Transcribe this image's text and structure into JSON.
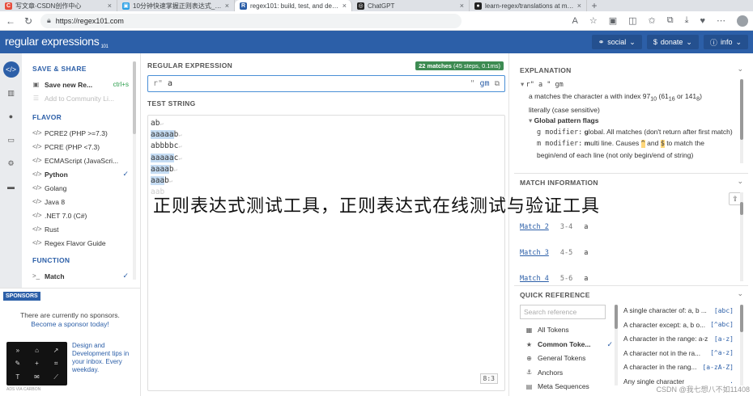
{
  "browser": {
    "tabs": [
      {
        "favicon": "C",
        "color": "#e74c3c",
        "title": "写文章-CSDN创作中心"
      },
      {
        "favicon": "▣",
        "color": "#2aa0e6",
        "title": "10分钟快速掌握正则表达式_脚本"
      },
      {
        "favicon": "R",
        "color": "#2c5fa8",
        "title": "regex101: build, test, and debug",
        "active": true
      },
      {
        "favicon": "◎",
        "color": "#222222",
        "title": "ChatGPT"
      },
      {
        "favicon": "●",
        "color": "#222222",
        "title": "learn-regex/translations at mast"
      }
    ],
    "url": "https://regex101.com"
  },
  "header": {
    "logo": "regular expressions",
    "logo_num": "101",
    "social_label": "social",
    "donate_label": "donate",
    "info_label": "info"
  },
  "sidebar": {
    "save_share_heading": "SAVE & SHARE",
    "save_label": "Save new Re...",
    "save_shortcut": "ctrl+s",
    "community_label": "Add to Community Li...",
    "flavor_heading": "FLAVOR",
    "flavors": [
      {
        "label": "PCRE2 (PHP >=7.3)",
        "selected": false
      },
      {
        "label": "PCRE (PHP <7.3)",
        "selected": false
      },
      {
        "label": "ECMAScript (JavaScri...",
        "selected": false
      },
      {
        "label": "Python",
        "selected": true
      },
      {
        "label": "Golang",
        "selected": false
      },
      {
        "label": "Java 8",
        "selected": false
      },
      {
        "label": ".NET 7.0 (C#)",
        "selected": false
      },
      {
        "label": "Rust",
        "selected": false
      },
      {
        "label": "Regex Flavor Guide",
        "selected": false
      }
    ],
    "function_heading": "FUNCTION",
    "function_label": "Match"
  },
  "sponsors": {
    "tag": "SPONSORS",
    "text": "There are currently no sponsors.",
    "link": "Become a sponsor today!",
    "ad_text": "Design and Development tips in your inbox. Every weekday.",
    "ad_note": "ADS VIA CARBON"
  },
  "regex": {
    "section_label": "REGULAR EXPRESSION",
    "matches_count": "22 matches",
    "matches_detail": "(45 steps, 0.1ms)",
    "prefix": "r\"",
    "pattern": "a",
    "suffix": "\"",
    "flags": "gm"
  },
  "test_string": {
    "section_label": "TEST STRING",
    "lines": [
      [
        {
          "t": "ab"
        }
      ],
      [
        {
          "t": "aaaaa",
          "h": true
        },
        {
          "t": "b"
        }
      ],
      [
        {
          "t": "abbbbc"
        }
      ],
      [
        {
          "t": "aaaaa",
          "h": true
        },
        {
          "t": "c"
        }
      ],
      [
        {
          "t": "aaaa",
          "h": true
        },
        {
          "t": "b"
        }
      ],
      [
        {
          "t": "aaa",
          "h": true
        },
        {
          "t": "b"
        }
      ]
    ],
    "faded_line": "aab",
    "ratio": "8:3"
  },
  "explanation": {
    "heading": "EXPLANATION",
    "pattern_line": "r\" a \" gm",
    "desc_a": "a matches the character a with index 97",
    "idx_sub1": "10",
    "idx_mid": " (61",
    "idx_sub2": "16",
    "idx_or": " or 141",
    "idx_sub3": "8",
    "idx_end": ")",
    "desc_b": "literally (case sensitive)",
    "flags_heading": "Global pattern flags",
    "g_code": "g modifier:",
    "g_bold": "g",
    "g_desc": "lobal. All matches (don't return after first match)",
    "m_code": "m modifier:",
    "m_bold": "m",
    "m_desc": "ulti line. Causes",
    "m_and": "and",
    "m_desc2": "to match the",
    "m_desc3": "begin/end of each line (not only begin/end of string)"
  },
  "match_info": {
    "heading": "MATCH INFORMATION",
    "items": [
      {
        "name": "Match 2",
        "range": "3-4",
        "value": "a"
      },
      {
        "name": "Match 3",
        "range": "4-5",
        "value": "a"
      },
      {
        "name": "Match 4",
        "range": "5-6",
        "value": "a"
      }
    ]
  },
  "quick_ref": {
    "heading": "QUICK REFERENCE",
    "search_placeholder": "Search reference",
    "categories": [
      {
        "icon": "▦",
        "label": "All Tokens",
        "bold": false
      },
      {
        "icon": "★",
        "label": "Common Toke...",
        "bold": true,
        "selected": true
      },
      {
        "icon": "⊕",
        "label": "General Tokens",
        "bold": false
      },
      {
        "icon": "⚓",
        "label": "Anchors",
        "bold": false
      },
      {
        "icon": "▤",
        "label": "Meta Sequences",
        "bold": false
      }
    ],
    "refs": [
      {
        "desc": "A single character of: a, b ...",
        "token": "[abc]"
      },
      {
        "desc": "A character except: a, b o...",
        "token": "[^abc]"
      },
      {
        "desc": "A character in the range: a-z",
        "token": "[a-z]"
      },
      {
        "desc": "A character not in the ra...",
        "token": "[^a-z]"
      },
      {
        "desc": "A character in the rang...",
        "token": "[a-zA-Z]"
      },
      {
        "desc": "Any single character",
        "token": "."
      }
    ]
  },
  "overlay": {
    "caption": "正则表达式测试工具，正则表达式在线测试与验证工具",
    "watermark": "CSDN @我七想八不如11408"
  }
}
